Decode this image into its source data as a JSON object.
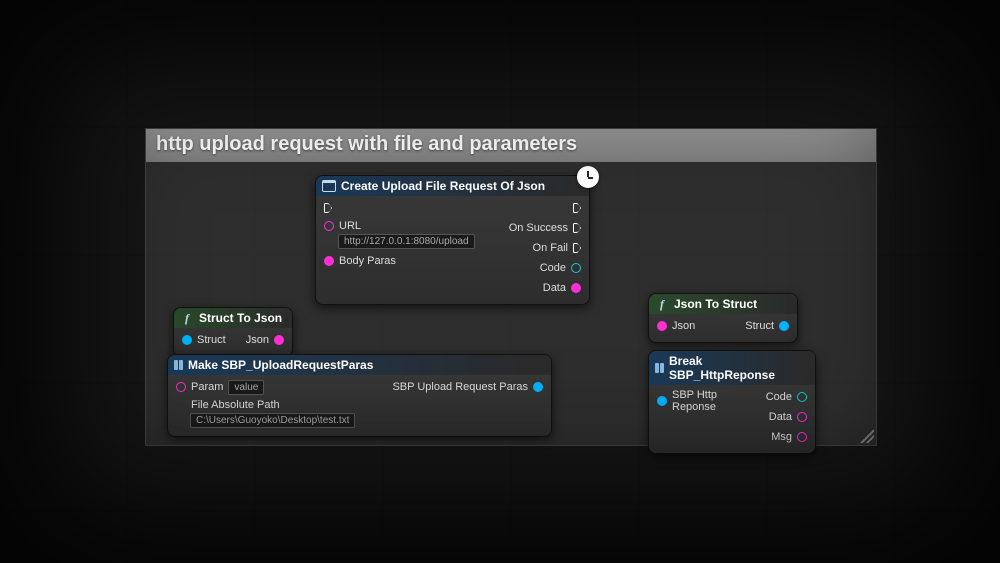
{
  "comment": {
    "title": "http upload request with file and parameters"
  },
  "nodes": {
    "createUpload": {
      "title": "Create Upload File Request Of Json",
      "urlLabel": "URL",
      "urlValue": "http://127.0.0.1:8080/upload",
      "bodyParasLabel": "Body Paras",
      "onSuccess": "On Success",
      "onFail": "On Fail",
      "code": "Code",
      "data": "Data"
    },
    "structToJson": {
      "title": "Struct To Json",
      "input": "Struct",
      "output": "Json"
    },
    "jsonToStruct": {
      "title": "Json To Struct",
      "input": "Json",
      "output": "Struct"
    },
    "makeParas": {
      "title": "Make SBP_UploadRequestParas",
      "paramLabel": "Param",
      "paramValue": "value",
      "pathLabel": "File Absolute Path",
      "pathValue": "C:\\Users\\Guoyoko\\Desktop\\test.txt",
      "output": "SBP Upload Request Paras"
    },
    "breakResp": {
      "title": "Break SBP_HttpReponse",
      "input": "SBP Http Reponse",
      "code": "Code",
      "data": "Data",
      "msg": "Msg"
    }
  }
}
